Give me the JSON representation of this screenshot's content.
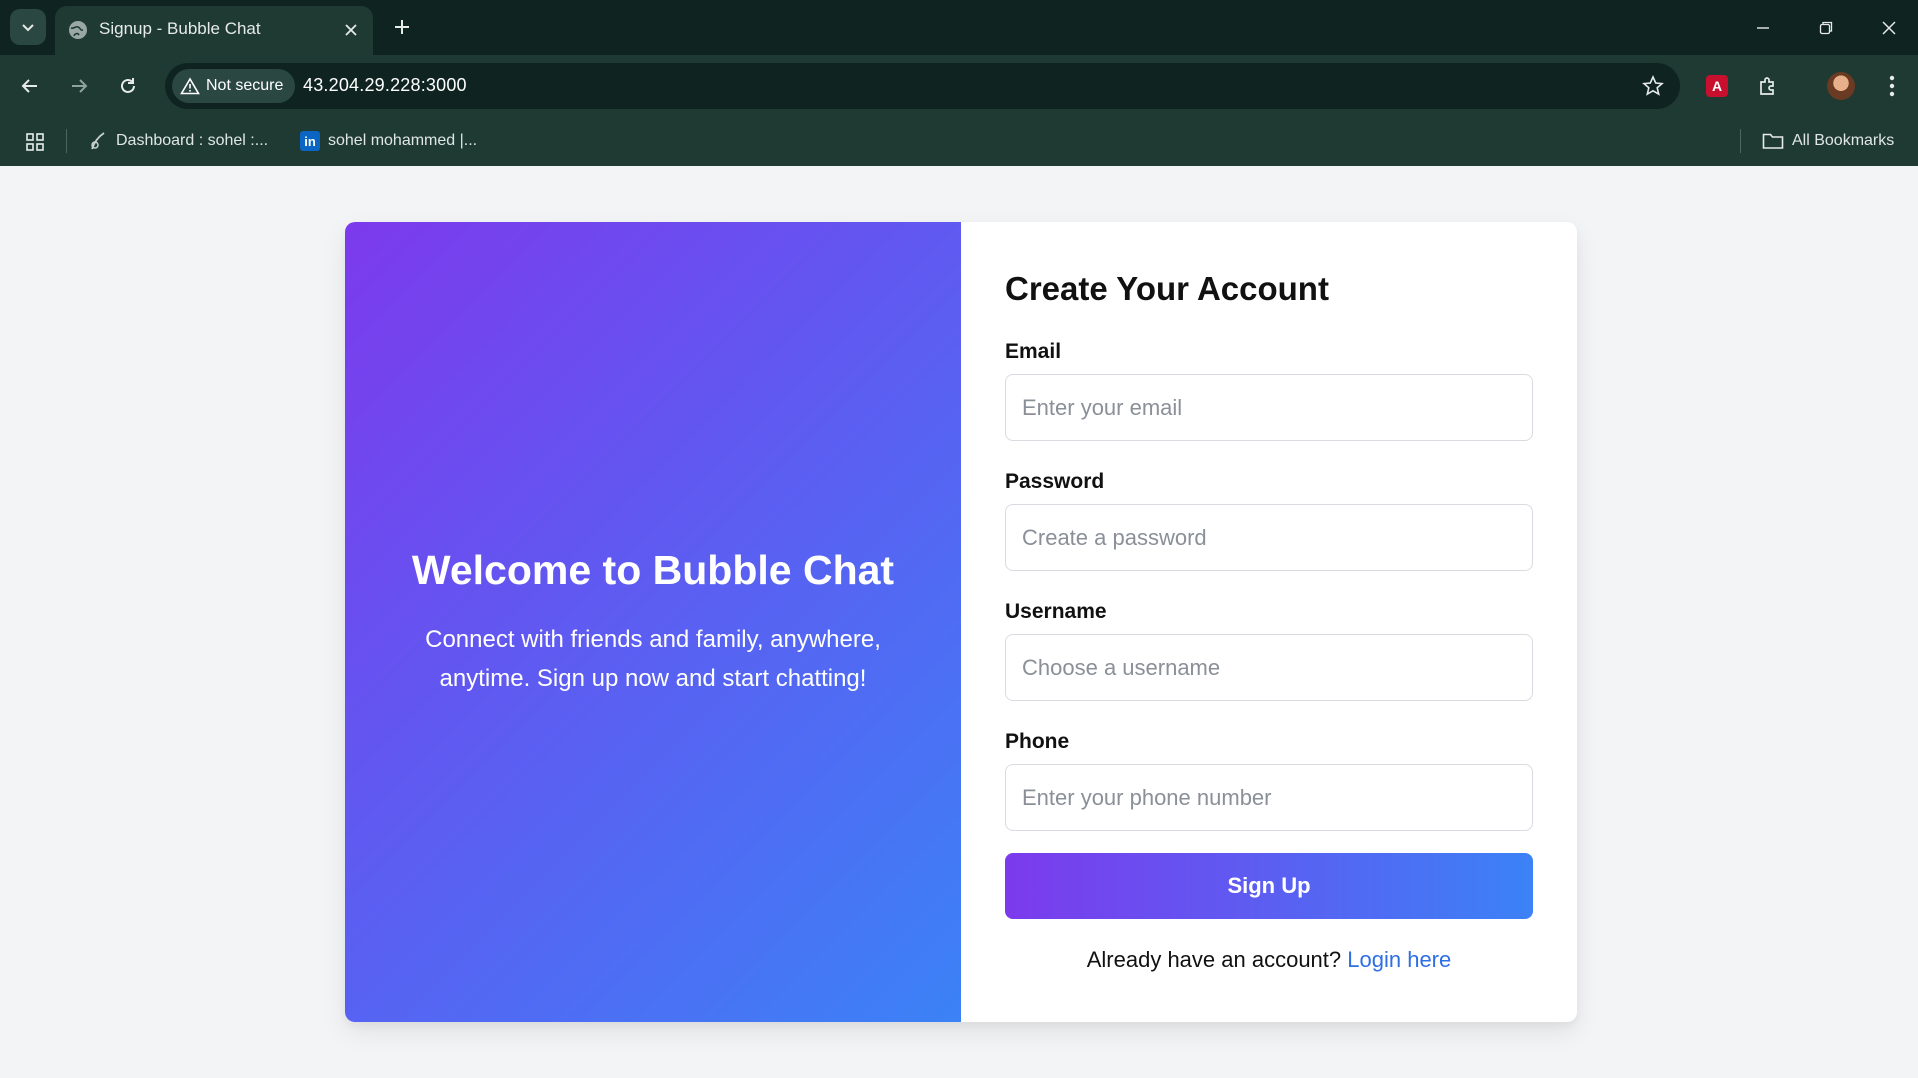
{
  "browser": {
    "tab_title": "Signup - Bubble Chat",
    "security_label": "Not secure",
    "url": "43.204.29.228:3000",
    "bookmarks": [
      {
        "label": "Dashboard : sohel :..."
      },
      {
        "label": "sohel mohammed |..."
      }
    ],
    "all_bookmarks_label": "All Bookmarks",
    "linkedin_glyph": "in",
    "pdf_glyph": "A"
  },
  "hero": {
    "title": "Welcome to Bubble Chat",
    "text": "Connect with friends and family, anywhere, anytime. Sign up now and start chatting!"
  },
  "form": {
    "title": "Create Your Account",
    "fields": [
      {
        "label": "Email",
        "placeholder": "Enter your email",
        "value": ""
      },
      {
        "label": "Password",
        "placeholder": "Create a password",
        "value": ""
      },
      {
        "label": "Username",
        "placeholder": "Choose a username",
        "value": ""
      },
      {
        "label": "Phone",
        "placeholder": "Enter your phone number",
        "value": ""
      }
    ],
    "submit_label": "Sign Up",
    "login_prompt": "Already have an account?",
    "login_link": "Login here"
  },
  "colors": {
    "gradient_start": "#7c3aed",
    "gradient_end": "#3b82f6",
    "link": "#2f6fe4",
    "chrome_bg": "#1f3a33"
  }
}
